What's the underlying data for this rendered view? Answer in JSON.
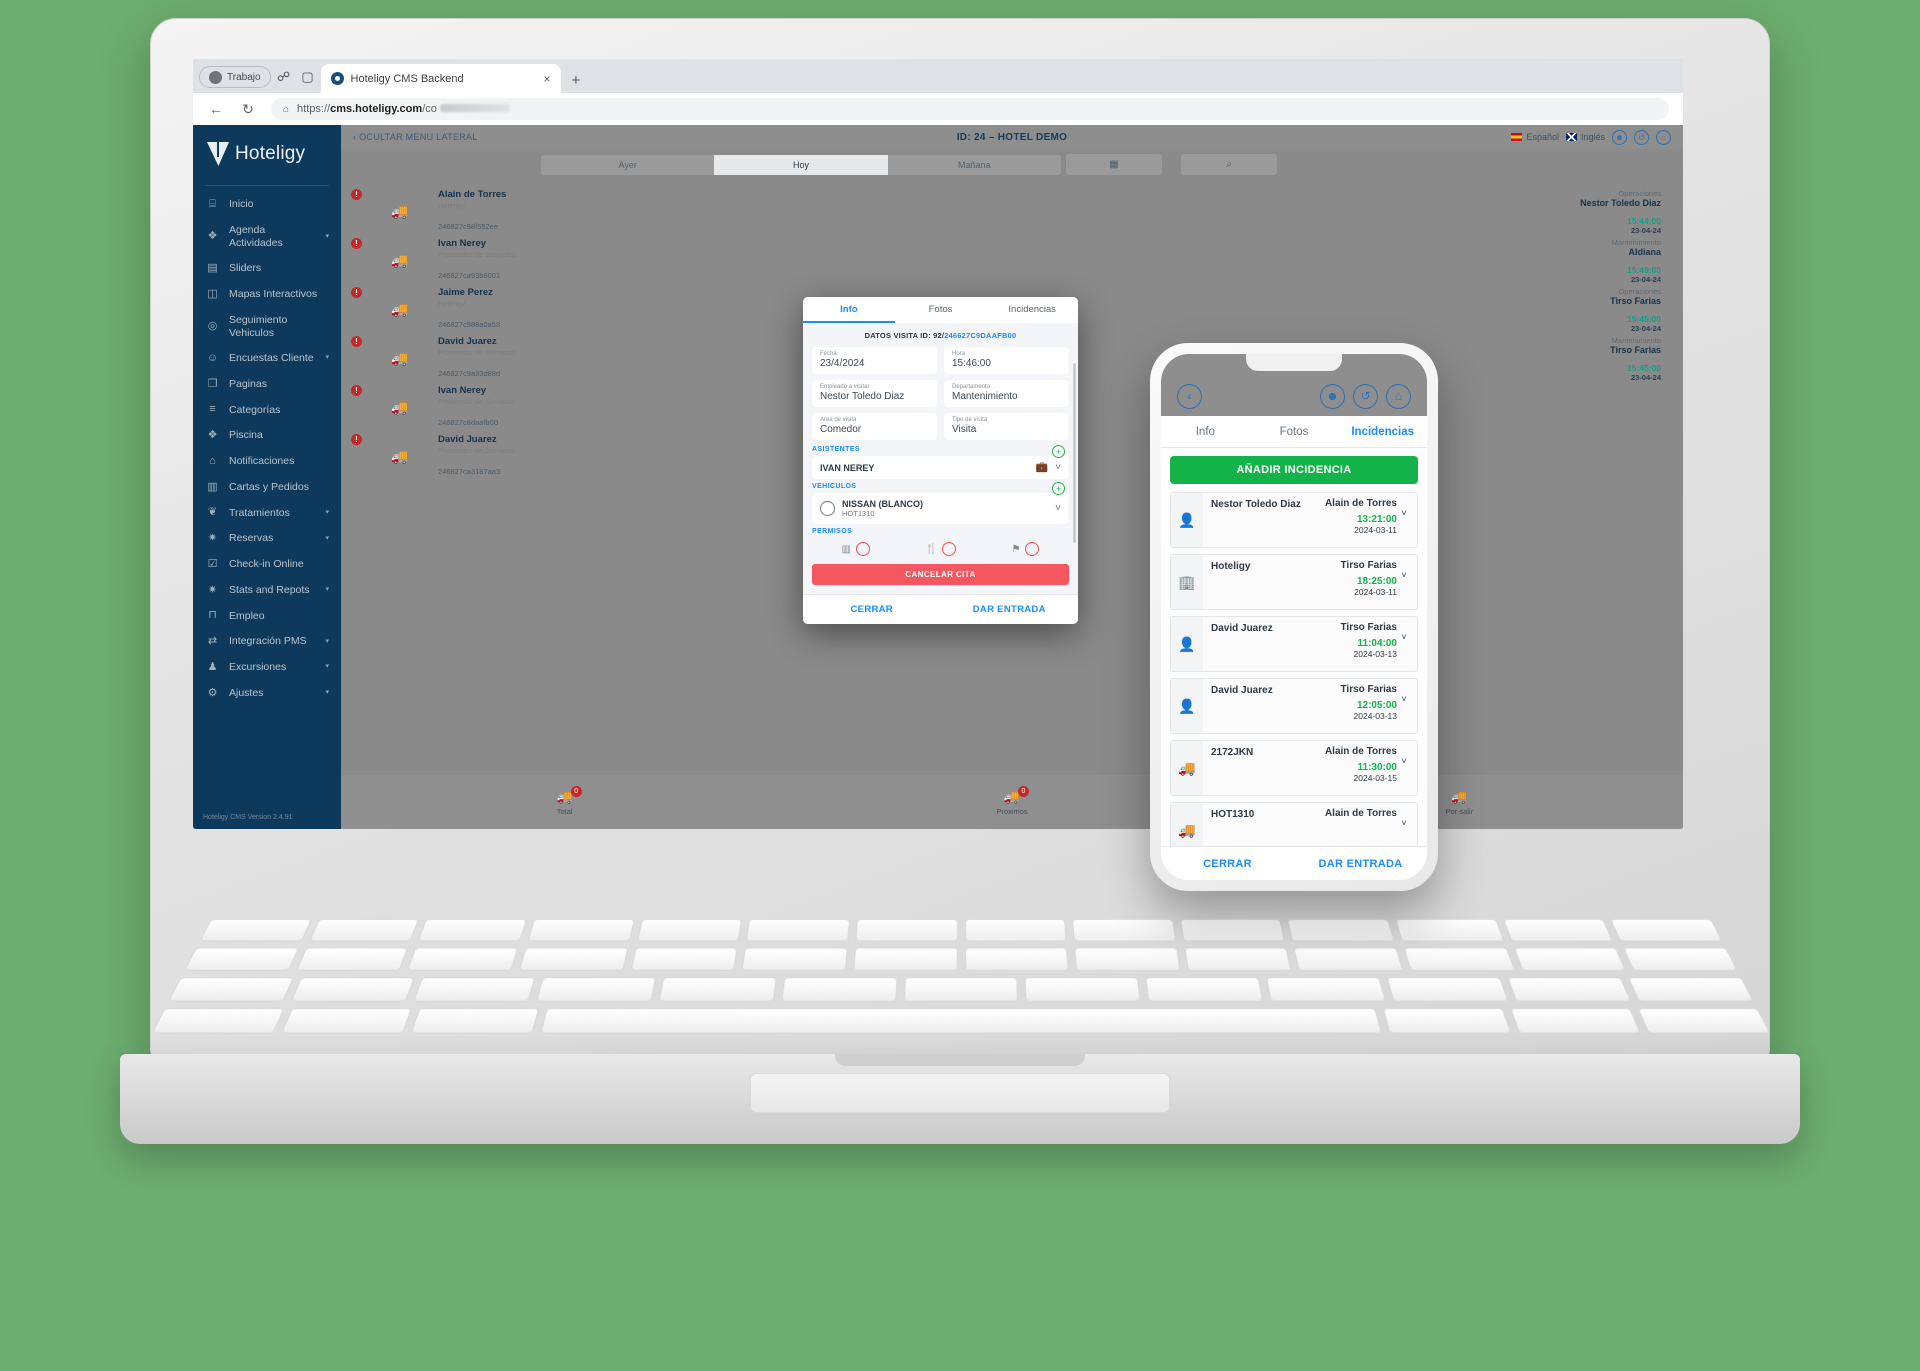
{
  "browser": {
    "profile_label": "Trabajo",
    "tab_title": "Hoteligy CMS Backend",
    "url_prefix": "https://",
    "url_domain": "cms.hoteligy.com",
    "url_path": "/co",
    "close_tab": "×",
    "new_tab": "+",
    "back": "←",
    "reload": "↻",
    "lock": "⌂"
  },
  "sidebar": {
    "brand": "Hoteligy",
    "version": "Hoteligy CMS Version 2.4.91",
    "items": [
      {
        "label": "Inicio",
        "icon": "dashboard-icon",
        "glyph": "⌸",
        "caret": ""
      },
      {
        "label": "Agenda Actividades",
        "icon": "calendar-icon",
        "glyph": "❖",
        "caret": "▾"
      },
      {
        "label": "Sliders",
        "icon": "slider-icon",
        "glyph": "▤",
        "caret": ""
      },
      {
        "label": "Mapas Interactivos",
        "icon": "map-icon",
        "glyph": "◫",
        "caret": ""
      },
      {
        "label": "Seguimiento Vehiculos",
        "icon": "target-icon",
        "glyph": "◎",
        "caret": ""
      },
      {
        "label": "Encuestas Cliente",
        "icon": "smiley-icon",
        "glyph": "☺",
        "caret": "▾"
      },
      {
        "label": "Paginas",
        "icon": "pages-icon",
        "glyph": "❐",
        "caret": ""
      },
      {
        "label": "Categorías",
        "icon": "list-icon",
        "glyph": "≡",
        "caret": ""
      },
      {
        "label": "Piscina",
        "icon": "pool-icon",
        "glyph": "❖",
        "caret": ""
      },
      {
        "label": "Notificaciones",
        "icon": "bell-icon",
        "glyph": "⌂",
        "caret": ""
      },
      {
        "label": "Cartas y Pedidos",
        "icon": "book-icon",
        "glyph": "▥",
        "caret": ""
      },
      {
        "label": "Tratamientos",
        "icon": "spa-icon",
        "glyph": "❦",
        "caret": "▾"
      },
      {
        "label": "Reservas",
        "icon": "ticket-icon",
        "glyph": "✷",
        "caret": "▾"
      },
      {
        "label": "Check-in Online",
        "icon": "checkin-icon",
        "glyph": "☑",
        "caret": ""
      },
      {
        "label": "Stats and Repots",
        "icon": "stats-icon",
        "glyph": "✷",
        "caret": "▾"
      },
      {
        "label": "Empleo",
        "icon": "briefcase-icon",
        "glyph": "⊓",
        "caret": ""
      },
      {
        "label": "Integración PMS",
        "icon": "exchange-icon",
        "glyph": "⇄",
        "caret": "▾"
      },
      {
        "label": "Excursiones",
        "icon": "hiking-icon",
        "glyph": "♟",
        "caret": "▾"
      },
      {
        "label": "Ajustes",
        "icon": "gear-icon",
        "glyph": "⚙",
        "caret": "▾"
      }
    ]
  },
  "topbar": {
    "hide_menu": "‹  OCULTAR MENU LATERAL",
    "hotel_id": "ID: 24 – HOTEL DEMO",
    "lang_es": "Español",
    "lang_en": "Inglés",
    "icon_user": "☻",
    "icon_refresh": "↺",
    "icon_bell": "⌂"
  },
  "filterbar": {
    "segments": [
      {
        "label": "Ayer",
        "active": false
      },
      {
        "label": "Hoy",
        "active": true
      },
      {
        "label": "Mañana",
        "active": false
      }
    ],
    "calendar_icon": "▦",
    "search_icon": "⌕"
  },
  "visit_list": [
    {
      "alert": "!",
      "name": "Alain de Torres",
      "role": "Hoteligy",
      "code": "246827c98f552ee",
      "dept": "Operaciones",
      "person": "Nestor Toledo Diaz",
      "time": "15:44:00",
      "date": "23-04-24"
    },
    {
      "alert": "!",
      "name": "Ivan Nerey",
      "role": "Proveedor de Servicios",
      "code": "246827ca93b8001",
      "dept": "Mantenimiento",
      "person": "Aldiana",
      "time": "15:49:00",
      "date": "23-04-24"
    },
    {
      "alert": "!",
      "name": "Jaime Perez",
      "role": "Hoteligy",
      "code": "246827c988a0a58",
      "dept": "Operaciones",
      "person": "Tirso Farias",
      "time": "15:45:00",
      "date": "23-04-24"
    },
    {
      "alert": "!",
      "name": "David Juarez",
      "role": "Proveedor de Servicios",
      "code": "246827c9a33d88d",
      "dept": "Mantenimiento",
      "person": "Tirso Farias",
      "time": "15:45:00",
      "date": "23-04-24"
    },
    {
      "alert": "!",
      "name": "Ivan Nerey",
      "role": "Proveedor de Servicios",
      "code": "246827c8daafb00",
      "dept": "",
      "person": "",
      "time": "",
      "date": ""
    },
    {
      "alert": "!",
      "name": "David Juarez",
      "role": "Proveedor de Servicios",
      "code": "246827ca3187aa3",
      "dept": "",
      "person": "",
      "time": "",
      "date": ""
    }
  ],
  "bottom_bar": [
    {
      "icon": "🚚",
      "label": "Total",
      "badge": "0"
    },
    {
      "icon": "🚚",
      "label": "Proximos",
      "badge": "0"
    },
    {
      "icon": "🚚",
      "label": "Por salir",
      "badge": ""
    }
  ],
  "modal": {
    "tabs": [
      {
        "label": "Info",
        "active": true
      },
      {
        "label": "Fotos",
        "active": false
      },
      {
        "label": "Incidencias",
        "active": false
      }
    ],
    "title_prefix": "DATOS VISITA ID: 92/",
    "title_code": "246627C9DAAFB00",
    "fields": [
      {
        "label": "Fecha",
        "value": "23/4/2024"
      },
      {
        "label": "Hora",
        "value": "15:46:00"
      },
      {
        "label": "Empleado a visitar",
        "value": "Nestor Toledo Diaz"
      },
      {
        "label": "Departamento",
        "value": "Mantenimiento"
      },
      {
        "label": "Area de visita",
        "value": "Comedor"
      },
      {
        "label": "Tipo de visita",
        "value": "Visita"
      }
    ],
    "asistentes_header": "ASISTENTES",
    "asistente_name": "IVAN NEREY",
    "asistente_icon": "💼",
    "vehiculos_header": "VEHICULOS",
    "vehiculo_name": "NISSAN (BLANCO)",
    "vehiculo_plate": "HOT1310",
    "permisos_header": "PERMISOS",
    "permisos": [
      {
        "icon": "▥",
        "name": "card-permission"
      },
      {
        "icon": "🍴",
        "name": "food-permission"
      },
      {
        "icon": "⚑",
        "name": "flag-permission"
      }
    ],
    "cancel_label": "CANCELAR CITA",
    "footer": [
      {
        "label": "CERRAR"
      },
      {
        "label": "DAR ENTRADA"
      }
    ],
    "chevron": "˅",
    "plus": "+"
  },
  "phone": {
    "back_icon": "‹",
    "icon_user": "☻",
    "icon_refresh": "↺",
    "icon_bell": "⌂",
    "tabs": [
      {
        "label": "Info",
        "active": false
      },
      {
        "label": "Fotos",
        "active": false
      },
      {
        "label": "Incidencias",
        "active": true
      }
    ],
    "add_button": "AÑADIR INCIDENCIA",
    "incidents": [
      {
        "icon": "👤",
        "subject": "Nestor Toledo Diaz",
        "who": "Alain de Torres",
        "time": "13:21:00",
        "date": "2024-03-11"
      },
      {
        "icon": "🏢",
        "subject": "Hoteligy",
        "who": "Tirso Farias",
        "time": "18:25:00",
        "date": "2024-03-11"
      },
      {
        "icon": "👤",
        "subject": "David Juarez",
        "who": "Tirso Farias",
        "time": "11:04:00",
        "date": "2024-03-13"
      },
      {
        "icon": "👤",
        "subject": "David Juarez",
        "who": "Tirso Farias",
        "time": "12:05:00",
        "date": "2024-03-13"
      },
      {
        "icon": "🚚",
        "subject": "2172JKN",
        "who": "Alain de Torres",
        "time": "11:30:00",
        "date": "2024-03-15"
      },
      {
        "icon": "🚚",
        "subject": "HOT1310",
        "who": "Alain de Torres",
        "time": "",
        "date": ""
      }
    ],
    "chevron": "˅",
    "footer": [
      {
        "label": "CERRAR"
      },
      {
        "label": "DAR ENTRADA"
      }
    ]
  },
  "colors": {
    "brand_navy": "#0d3a5c",
    "accent_blue": "#1a8cff",
    "green": "#13b34a",
    "red": "#f5565f",
    "alert_red": "#c62828"
  }
}
